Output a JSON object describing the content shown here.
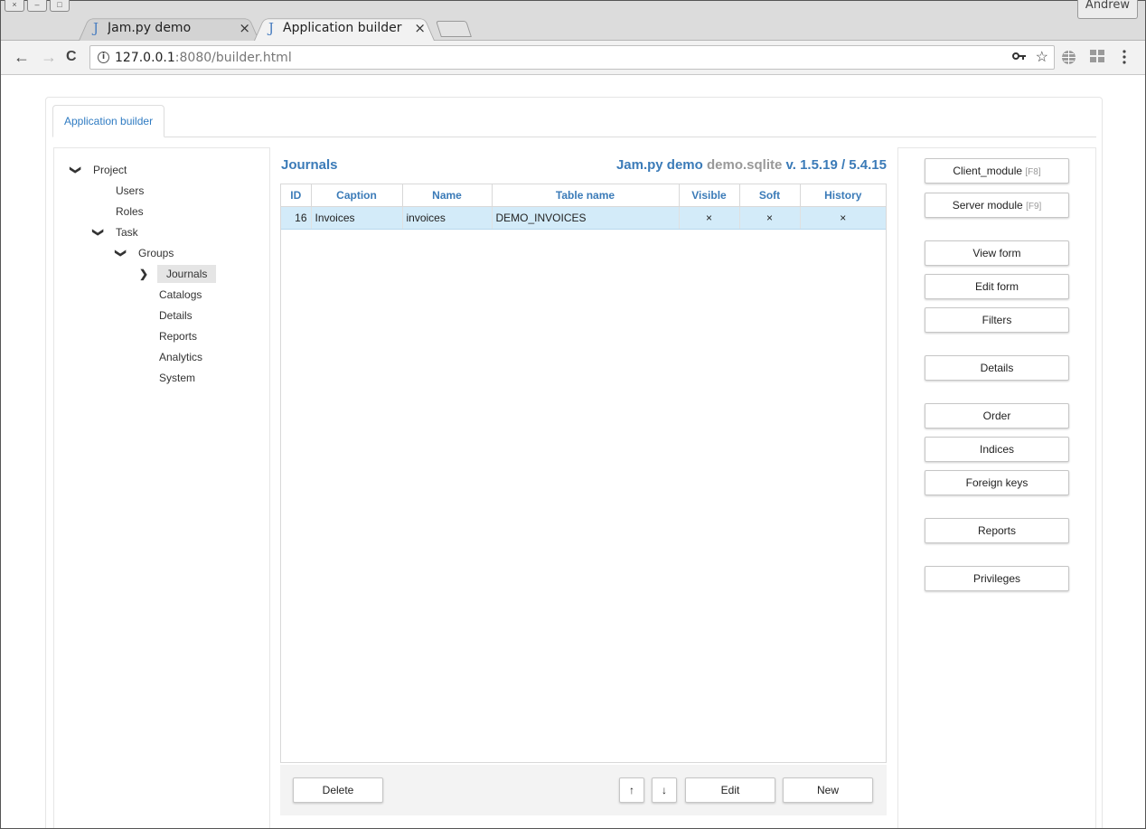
{
  "browser": {
    "window_buttons": [
      "×",
      "–",
      "□"
    ],
    "user": "Andrew",
    "tabs": [
      {
        "favicon": "J",
        "title": "Jam.py demo",
        "close": "×"
      },
      {
        "favicon": "J",
        "title": "Application builder",
        "close": "×"
      }
    ],
    "url_host": "127.0.0.1",
    "url_rest": ":8080/builder.html",
    "nav": {
      "back": "←",
      "forward": "→",
      "reload": "C"
    },
    "icons": {
      "key": "key-icon",
      "star": "star-icon",
      "globe": "globe-icon",
      "apps": "apps-icon",
      "menu": "menu-icon"
    }
  },
  "app": {
    "tab_label": "Application builder",
    "tree": [
      {
        "label": "Project",
        "caret": "down"
      },
      {
        "label": "Users",
        "caret": ""
      },
      {
        "label": "Roles",
        "caret": ""
      },
      {
        "label": "Task",
        "caret": "down"
      },
      {
        "label": "Groups",
        "caret": "down"
      },
      {
        "label": "Journals",
        "caret": "right"
      },
      {
        "label": "Catalogs",
        "caret": ""
      },
      {
        "label": "Details",
        "caret": ""
      },
      {
        "label": "Reports",
        "caret": ""
      },
      {
        "label": "Analytics",
        "caret": ""
      },
      {
        "label": "System",
        "caret": ""
      }
    ],
    "center": {
      "title": "Journals",
      "project_name": "Jam.py demo",
      "db": "demo.sqlite",
      "version": "v. 1.5.19 / 5.4.15",
      "columns": [
        "ID",
        "Caption",
        "Name",
        "Table name",
        "Visible",
        "Soft",
        "History"
      ],
      "rows": [
        {
          "id": "16",
          "caption": "Invoices",
          "name": "invoices",
          "table_name": "DEMO_INVOICES",
          "visible": "×",
          "soft": "×",
          "history": "×"
        }
      ],
      "buttons": {
        "delete": "Delete",
        "up": "↑",
        "down": "↓",
        "edit": "Edit",
        "new": "New"
      }
    },
    "right_buttons": {
      "client_module": "Client_module",
      "client_hint": "[F8]",
      "server_module": "Server module",
      "server_hint": "[F9]",
      "view_form": "View form",
      "edit_form": "Edit form",
      "filters": "Filters",
      "details": "Details",
      "order": "Order",
      "indices": "Indices",
      "foreign_keys": "Foreign keys",
      "reports": "Reports",
      "privileges": "Privileges"
    },
    "colors": {
      "accent": "#3b7bb8",
      "selection": "#d3ebf9"
    }
  }
}
